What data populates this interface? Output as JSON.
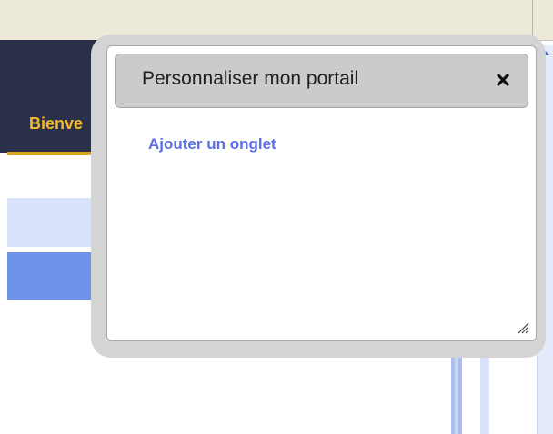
{
  "page": {
    "welcome_text": "Bienve"
  },
  "dialog": {
    "title": "Personnaliser mon portail",
    "close_icon": "close-icon",
    "add_tab_link": "Ajouter un onglet",
    "resize_icon": "resize-grip-icon"
  },
  "colors": {
    "header_dark": "#2a3049",
    "welcome_yellow": "#f2b82a",
    "link_blue": "#5b6de7",
    "titlebar_gray": "#cbcbcb"
  }
}
